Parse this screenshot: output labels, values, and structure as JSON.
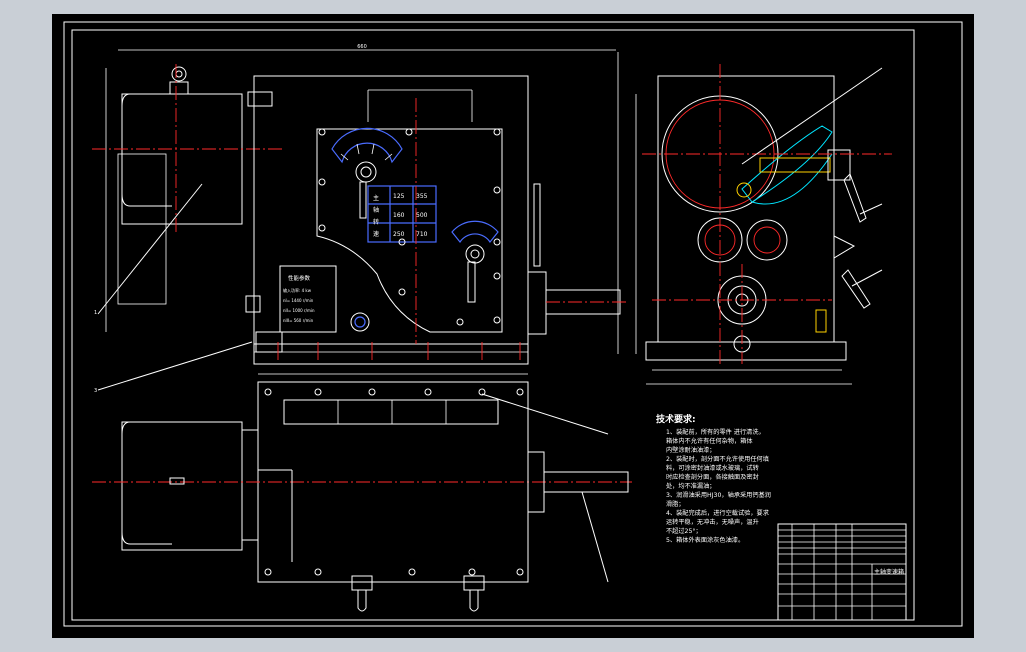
{
  "drawing": {
    "tech_req_title": "技术要求:",
    "tech_req": [
      "1、装配前，所有的零件  进行清洗，",
      "    箱体内不允许有任何杂物，箱体",
      "    内壁涂耐油油漆；",
      "2、装配时，剖分面不允许使用任何填",
      "    料，可涂密封油漆或水玻璃，试转",
      "    时应检查剖分面，各接触面及密封",
      "    处，均不准漏油；",
      "3、润滑油采用HJ30，轴承采用钙基润",
      "    滑脂；",
      "4、装配完成后，进行空载试验，要求",
      "    运转平稳，无冲击，无噪声，温升",
      "    不超过25°；",
      "5、箱体外表面涂灰色油漆。"
    ],
    "plate_title": "性能参数",
    "plate_lines": [
      "输入功率: 4 kw",
      "nI=  1440 r/min",
      "nII=  1000 r/min",
      "nIII=  560 r/min"
    ],
    "speed_table": [
      "125",
      "355",
      "160",
      "500",
      "250",
      "710"
    ],
    "panel_chars": [
      "主",
      "轴",
      "转",
      "速"
    ],
    "block_title": "主轴变速箱"
  }
}
